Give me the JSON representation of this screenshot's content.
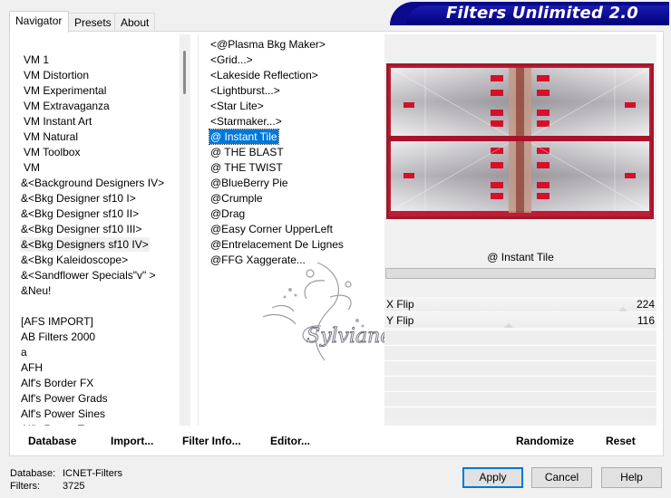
{
  "banner": {
    "title": "Filters Unlimited 2.0"
  },
  "tabs": [
    {
      "label": "Navigator",
      "active": true
    },
    {
      "label": "Presets",
      "active": false
    },
    {
      "label": "About",
      "active": false
    }
  ],
  "categories": [
    {
      "label": "VM 1"
    },
    {
      "label": "VM Distortion"
    },
    {
      "label": "VM Experimental"
    },
    {
      "label": "VM Extravaganza"
    },
    {
      "label": "VM Instant Art"
    },
    {
      "label": "VM Natural"
    },
    {
      "label": "VM Toolbox"
    },
    {
      "label": "VM"
    },
    {
      "label": "&<Background Designers IV>"
    },
    {
      "label": "&<Bkg Designer sf10 I>"
    },
    {
      "label": "&<Bkg Designer sf10 II>"
    },
    {
      "label": "&<Bkg Designer sf10 III>"
    },
    {
      "label": "&<Bkg Designers sf10 IV>",
      "selected": true
    },
    {
      "label": "&<Bkg Kaleidoscope>"
    },
    {
      "label": "&<Sandflower Specials\"v\" >"
    },
    {
      "label": "&Neu!"
    },
    {
      "label": ""
    },
    {
      "label": "[AFS IMPORT]"
    },
    {
      "label": "AB Filters 2000"
    },
    {
      "label": "a"
    },
    {
      "label": "AFH"
    },
    {
      "label": "Alf's Border FX"
    },
    {
      "label": "Alf's Power Grads"
    },
    {
      "label": "Alf's Power Sines"
    },
    {
      "label": "Alf's Power Toys"
    }
  ],
  "filters": [
    {
      "label": "<@Plasma Bkg Maker>"
    },
    {
      "label": "<Grid...>"
    },
    {
      "label": "<Lakeside Reflection>"
    },
    {
      "label": "<Lightburst...>"
    },
    {
      "label": "<Star Lite>"
    },
    {
      "label": "<Starmaker...>"
    },
    {
      "label": "@ Instant Tile",
      "selected": true
    },
    {
      "label": "@ THE BLAST"
    },
    {
      "label": "@ THE TWIST"
    },
    {
      "label": "@BlueBerry Pie"
    },
    {
      "label": "@Crumple"
    },
    {
      "label": "@Drag"
    },
    {
      "label": "@Easy Corner UpperLeft"
    },
    {
      "label": "@Entrelacement De Lignes"
    },
    {
      "label": "@FFG Xaggerate..."
    }
  ],
  "watermark": {
    "text": "Sylviane"
  },
  "preview": {
    "selected_filter": "@ Instant Tile"
  },
  "params": [
    {
      "label": "X Flip",
      "value": "224",
      "level": 0.878
    },
    {
      "label": "Y Flip",
      "value": "116",
      "level": 0.455
    }
  ],
  "buttons": {
    "database": "Database",
    "import": "Import...",
    "filter_info": "Filter Info...",
    "editor": "Editor...",
    "randomize": "Randomize",
    "reset": "Reset"
  },
  "status": {
    "database_label": "Database:",
    "database_value": "ICNET-Filters",
    "filters_label": "Filters:",
    "filters_value": "3725"
  },
  "dialog": {
    "apply": "Apply",
    "cancel": "Cancel",
    "help": "Help"
  },
  "colors": {
    "selection": "#0078d7",
    "banner": "#0a0a8a",
    "preview_accent": "#c8102e"
  }
}
